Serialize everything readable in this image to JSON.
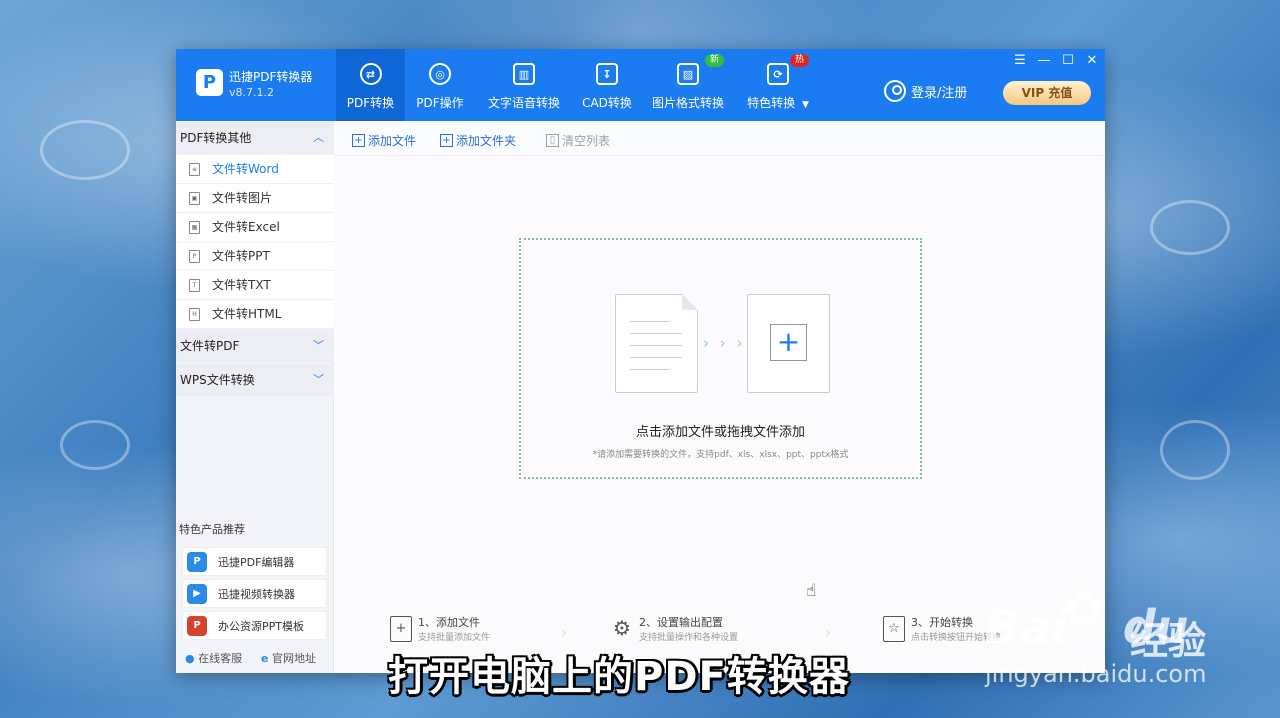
{
  "app": {
    "name": "迅捷PDF转换器",
    "version": "v8.7.1.2",
    "logo_letter": "P"
  },
  "nav": {
    "tabs": [
      {
        "label": "PDF转换",
        "icon": "⇄",
        "active": true
      },
      {
        "label": "PDF操作",
        "icon": "◎"
      },
      {
        "label": "文字语音转换",
        "icon": "▥"
      },
      {
        "label": "CAD转换",
        "icon": "↧"
      },
      {
        "label": "图片格式转换",
        "icon": "▨"
      },
      {
        "label": "特色转换",
        "icon": "⟳"
      }
    ],
    "badge_new": "新",
    "badge_hot": "热",
    "dropdown_arrow": "▼"
  },
  "window_controls": {
    "menu": "☰",
    "minimize": "—",
    "maximize": "☐",
    "close": "✕"
  },
  "account": {
    "login": "登录/注册",
    "vip": "VIP 充值"
  },
  "sidebar": {
    "section1": {
      "title": "PDF转换其他",
      "chevron": "︿"
    },
    "items": [
      {
        "label": "文件转Word",
        "icon": "≡"
      },
      {
        "label": "文件转图片",
        "icon": "▣"
      },
      {
        "label": "文件转Excel",
        "icon": "▦"
      },
      {
        "label": "文件转PPT",
        "icon": "P"
      },
      {
        "label": "文件转TXT",
        "icon": "T"
      },
      {
        "label": "文件转HTML",
        "icon": "H"
      }
    ],
    "section2": {
      "title": "文件转PDF",
      "chevron": "﹀"
    },
    "section3": {
      "title": "WPS文件转换",
      "chevron": "﹀"
    },
    "recommend_title": "特色产品推荐",
    "recommend": [
      {
        "label": "迅捷PDF编辑器",
        "icon": "P",
        "color": "#2a8be6"
      },
      {
        "label": "迅捷视频转换器",
        "icon": "▶",
        "color": "#2a8be6"
      },
      {
        "label": "办公资源PPT模板",
        "icon": "P",
        "color": "#d2452c"
      }
    ],
    "footer": {
      "service": "在线客服",
      "website": "官网地址"
    }
  },
  "toolbar": {
    "add_file": "添加文件",
    "add_folder": "添加文件夹",
    "clear_list": "清空列表"
  },
  "dropzone": {
    "arrows": "› › ›",
    "plus": "+",
    "title": "点击添加文件或拖拽文件添加",
    "hint": "*请添加需要转换的文件，支持pdf、xls、xlsx、ppt、pptx格式"
  },
  "steps": [
    {
      "title": "1、添加文件",
      "desc": "支持批量添加文件",
      "icon": "+"
    },
    {
      "title": "2、设置输出配置",
      "desc": "支持批量操作和各种设置",
      "icon": "⚙"
    },
    {
      "title": "3、开始转换",
      "desc": "点击转换按钮开始转换",
      "icon": "☆"
    }
  ],
  "step_separator": "›",
  "caption": "打开电脑上的PDF转换器",
  "watermark": {
    "logo": "Bai",
    "logo2": "du",
    "cn": "经验",
    "url": "jingyan.baidu.com"
  },
  "colors": {
    "brand": "#1a7cf0",
    "vip_text": "#8a4d12",
    "badge_new": "#2fbf3c",
    "badge_hot": "#e02424"
  }
}
